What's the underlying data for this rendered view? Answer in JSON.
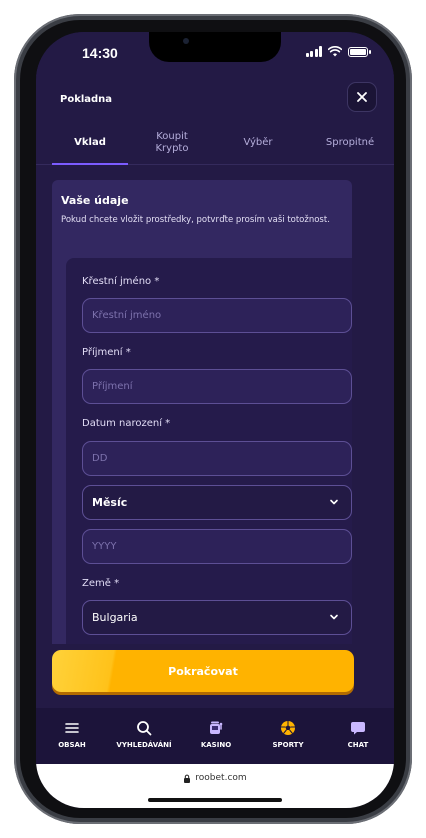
{
  "status_bar": {
    "time": "14:30"
  },
  "header": {
    "title": "Pokladna",
    "close_icon": "close-icon"
  },
  "tabs": [
    {
      "label": "Vklad",
      "active": true
    },
    {
      "label": "Koupit Krypto",
      "active": false
    },
    {
      "label": "Výběr",
      "active": false
    },
    {
      "label": "Spropitné",
      "active": false
    }
  ],
  "section": {
    "title": "Vaše údaje",
    "description": "Pokud chcete vložit prostředky, potvrďte prosím vaši totožnost."
  },
  "form": {
    "first_name": {
      "label": "Křestní jméno *",
      "placeholder": "Křestní jméno"
    },
    "last_name": {
      "label": "Příjmení *",
      "placeholder": "Příjmení"
    },
    "birth_date": {
      "label": "Datum narození *",
      "day_placeholder": "DD",
      "month_value": "Měsíc",
      "year_placeholder": "YYYY"
    },
    "country": {
      "label": "Země *",
      "value": "Bulgaria"
    }
  },
  "cta": {
    "label": "Pokračovat"
  },
  "bottom_nav": [
    {
      "label": "OBSAH",
      "icon": "menu-icon"
    },
    {
      "label": "VYHLEDÁVÁNÍ",
      "icon": "search-icon"
    },
    {
      "label": "KASINO",
      "icon": "slot-machine-icon"
    },
    {
      "label": "SPORTY",
      "icon": "soccer-ball-icon"
    },
    {
      "label": "CHAT",
      "icon": "chat-bubble-icon"
    }
  ],
  "browser": {
    "url": "roobet.com"
  },
  "colors": {
    "accent": "#7c5cff",
    "cta": "#ffb300",
    "background": "#231a45"
  }
}
